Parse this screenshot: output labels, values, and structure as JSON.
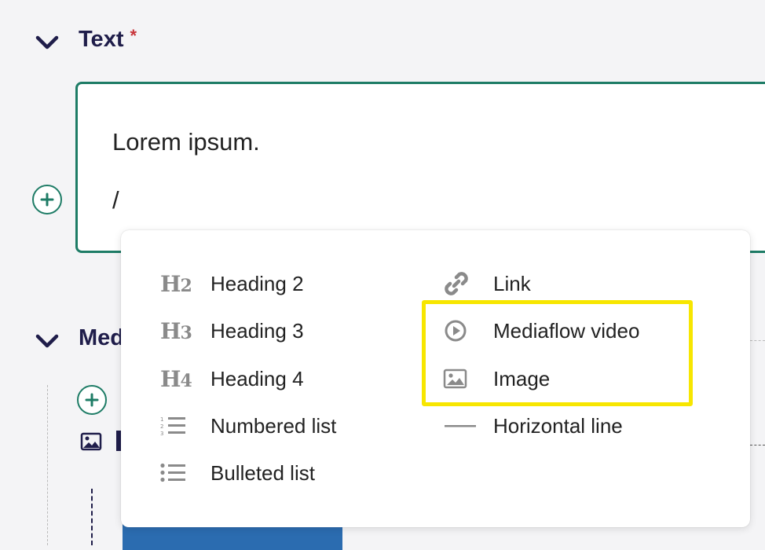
{
  "sections": {
    "text": {
      "title": "Text",
      "required_mark": "*"
    },
    "media": {
      "title_visible": "Med"
    }
  },
  "editor": {
    "lines": [
      "Lorem ipsum.",
      "/"
    ]
  },
  "menu": {
    "items": [
      {
        "label": "Heading 2",
        "icon": "heading-2-icon",
        "glyph_main": "H",
        "glyph_sub": "2"
      },
      {
        "label": "Heading 3",
        "icon": "heading-3-icon",
        "glyph_main": "H",
        "glyph_sub": "3"
      },
      {
        "label": "Heading 4",
        "icon": "heading-4-icon",
        "glyph_main": "H",
        "glyph_sub": "4"
      },
      {
        "label": "Numbered list",
        "icon": "numbered-list-icon"
      },
      {
        "label": "Bulleted list",
        "icon": "bulleted-list-icon"
      },
      {
        "label": "Link",
        "icon": "link-icon"
      },
      {
        "label": "Mediaflow video",
        "icon": "play-circle-icon"
      },
      {
        "label": "Image",
        "icon": "image-icon"
      },
      {
        "label": "Horizontal line",
        "icon": "horizontal-line-icon"
      }
    ]
  },
  "colors": {
    "accent": "#1e7c66",
    "title": "#1f1d4a",
    "required": "#c8353b",
    "highlight": "#f7e600"
  }
}
